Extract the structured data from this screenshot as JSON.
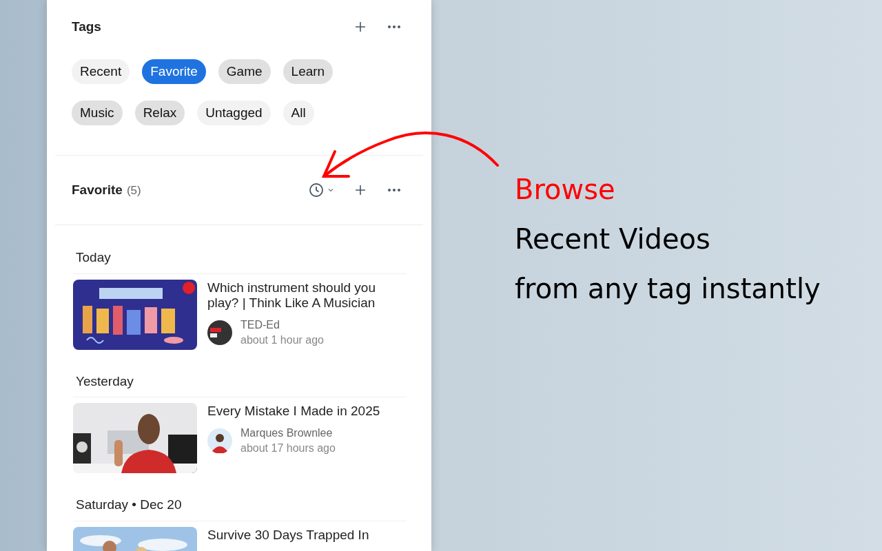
{
  "tags_panel": {
    "title": "Tags",
    "tags": [
      {
        "label": "Recent",
        "kind": "builtin",
        "selected": false
      },
      {
        "label": "Favorite",
        "kind": "custom",
        "selected": true
      },
      {
        "label": "Game",
        "kind": "custom",
        "selected": false
      },
      {
        "label": "Learn",
        "kind": "custom",
        "selected": false
      },
      {
        "label": "Music",
        "kind": "custom",
        "selected": false
      },
      {
        "label": "Relax",
        "kind": "custom",
        "selected": false
      },
      {
        "label": "Untagged",
        "kind": "builtin",
        "selected": false
      },
      {
        "label": "All",
        "kind": "builtin",
        "selected": false
      }
    ]
  },
  "tag_videos": {
    "title": "Favorite",
    "count": "(5)",
    "groups": [
      {
        "label": "Today",
        "videos": [
          {
            "title": "Which instrument should you play? | Think Like A Musician",
            "channel": "TED-Ed",
            "time": "about 1 hour ago"
          }
        ]
      },
      {
        "label": "Yesterday",
        "videos": [
          {
            "title": "Every Mistake I Made in 2025",
            "channel": "Marques Brownlee",
            "time": "about 17 hours ago"
          }
        ]
      },
      {
        "label": "Saturday • Dec 20",
        "videos": [
          {
            "title": "Survive 30 Days Trapped In"
          }
        ]
      }
    ]
  },
  "annotation": {
    "headline": "Browse",
    "lines": [
      "Recent Videos",
      "from any tag instantly"
    ]
  }
}
